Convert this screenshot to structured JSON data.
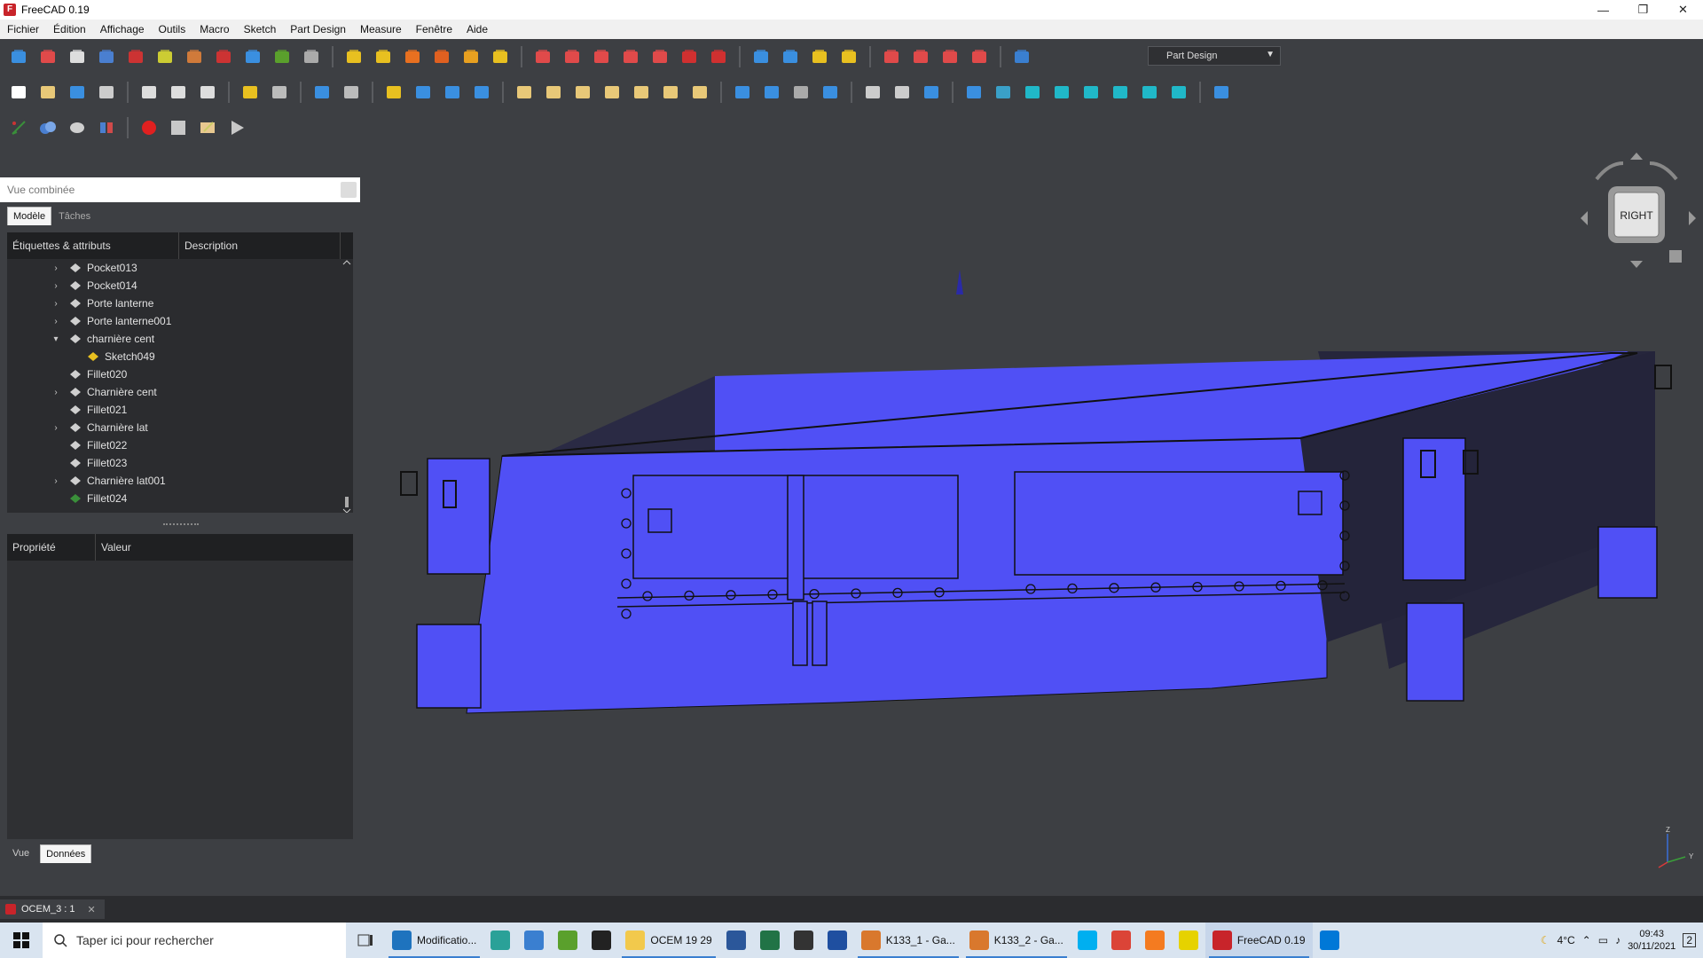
{
  "window": {
    "title": "FreeCAD 0.19",
    "controls": [
      "—",
      "❐",
      "✕"
    ]
  },
  "menu": [
    "Fichier",
    "Édition",
    "Affichage",
    "Outils",
    "Macro",
    "Sketch",
    "Part Design",
    "Measure",
    "Fenêtre",
    "Aide"
  ],
  "workbench": {
    "selected": "Part Design"
  },
  "combo": {
    "title": "Vue combinée",
    "tabs": [
      "Modèle",
      "Tâches"
    ],
    "tree_columns": [
      "Étiquettes & attributs",
      "Description"
    ],
    "tree_items": [
      {
        "label": "Pocket013",
        "expandable": true,
        "expanded": false,
        "level": 0,
        "icon": "pocket-icon"
      },
      {
        "label": "Pocket014",
        "expandable": true,
        "expanded": false,
        "level": 0,
        "icon": "pocket-icon"
      },
      {
        "label": "Porte lanterne",
        "expandable": true,
        "expanded": false,
        "level": 0,
        "icon": "pad-icon"
      },
      {
        "label": "Porte lanterne001",
        "expandable": true,
        "expanded": false,
        "level": 0,
        "icon": "pad-icon"
      },
      {
        "label": "charnière cent",
        "expandable": true,
        "expanded": true,
        "level": 0,
        "icon": "pad-icon"
      },
      {
        "label": "Sketch049",
        "expandable": false,
        "expanded": false,
        "level": 1,
        "icon": "sketch-icon"
      },
      {
        "label": "Fillet020",
        "expandable": false,
        "expanded": false,
        "level": 0,
        "icon": "fillet-icon"
      },
      {
        "label": "Charnière cent",
        "expandable": true,
        "expanded": false,
        "level": 0,
        "icon": "pad-icon"
      },
      {
        "label": "Fillet021",
        "expandable": false,
        "expanded": false,
        "level": 0,
        "icon": "fillet-icon"
      },
      {
        "label": "Charnière lat",
        "expandable": true,
        "expanded": false,
        "level": 0,
        "icon": "pad-icon"
      },
      {
        "label": "Fillet022",
        "expandable": false,
        "expanded": false,
        "level": 0,
        "icon": "fillet-icon"
      },
      {
        "label": "Fillet023",
        "expandable": false,
        "expanded": false,
        "level": 0,
        "icon": "fillet-icon"
      },
      {
        "label": "Charnière lat001",
        "expandable": true,
        "expanded": false,
        "level": 0,
        "icon": "pad-icon"
      },
      {
        "label": "Fillet024",
        "expandable": false,
        "expanded": false,
        "level": 0,
        "icon": "fillet-tip-icon"
      }
    ],
    "prop_columns": [
      "Propriété",
      "Valeur"
    ],
    "bottom_tabs": [
      "Vue",
      "Données"
    ],
    "active_bottom_tab": "Données"
  },
  "navcube": {
    "face": "RIGHT"
  },
  "document_tab": {
    "label": "OCEM_3 : 1"
  },
  "taskbar": {
    "search_placeholder": "Taper ici pour rechercher",
    "apps": [
      {
        "label": "Modificatio...",
        "icon": "edge-icon",
        "color": "#1e73be"
      },
      {
        "label": "",
        "icon": "app-icon",
        "color": "#2aa198"
      },
      {
        "label": "",
        "icon": "plane-icon",
        "color": "#3a7fd0"
      },
      {
        "label": "",
        "icon": "notepad-icon",
        "color": "#5aa02c"
      },
      {
        "label": "",
        "icon": "7zip-icon",
        "color": "#222"
      },
      {
        "label": "OCEM 19 29",
        "icon": "folder-icon",
        "color": "#f2c94c"
      },
      {
        "label": "",
        "icon": "word-icon",
        "color": "#2b579a"
      },
      {
        "label": "",
        "icon": "excel-icon",
        "color": "#217346"
      },
      {
        "label": "",
        "icon": "app-icon",
        "color": "#333"
      },
      {
        "label": "",
        "icon": "app-icon",
        "color": "#1f4fa0"
      },
      {
        "label": "K133_1 - Ga...",
        "icon": "app-icon",
        "color": "#d9782d"
      },
      {
        "label": "K133_2 - Ga...",
        "icon": "app-icon",
        "color": "#d9782d"
      },
      {
        "label": "",
        "icon": "skype-icon",
        "color": "#00aff0"
      },
      {
        "label": "",
        "icon": "chrome-icon",
        "color": "#db4437"
      },
      {
        "label": "",
        "icon": "app-icon",
        "color": "#f47b20"
      },
      {
        "label": "",
        "icon": "app-icon",
        "color": "#e6d200"
      },
      {
        "label": "FreeCAD 0.19",
        "icon": "freecad-icon",
        "color": "#c8242a",
        "active": true
      },
      {
        "label": "",
        "icon": "app-icon",
        "color": "#0078d7"
      }
    ],
    "weather": "4°C",
    "time": "09:43",
    "date": "30/11/2021",
    "notifications": "2"
  },
  "colors": {
    "model": "#5050f5",
    "model_dark": "#2a2a44",
    "background": "#3d3f43"
  }
}
